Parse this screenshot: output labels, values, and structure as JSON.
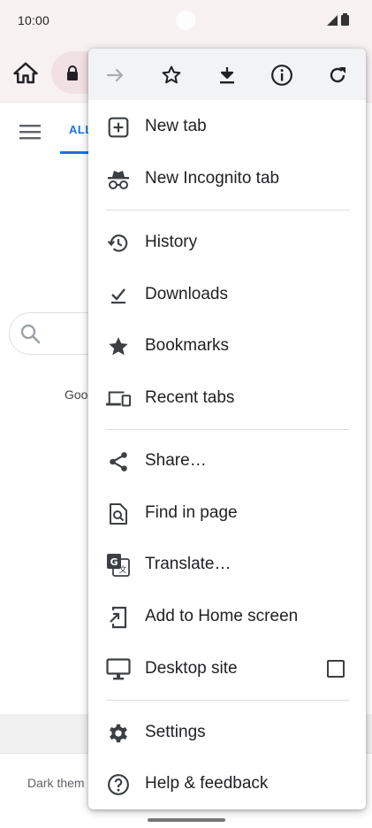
{
  "status_bar": {
    "time": "10:00"
  },
  "page_behind": {
    "tab_label": "ALL",
    "partial_text": "Goo",
    "footer_text": "Dark them"
  },
  "menu": {
    "top_actions": [
      {
        "name": "forward",
        "enabled": false
      },
      {
        "name": "bookmark-star"
      },
      {
        "name": "download"
      },
      {
        "name": "page-info"
      },
      {
        "name": "reload"
      }
    ],
    "items": {
      "new_tab": "New tab",
      "new_incognito_tab": "New Incognito tab",
      "history": "History",
      "downloads": "Downloads",
      "bookmarks": "Bookmarks",
      "recent_tabs": "Recent tabs",
      "share": "Share…",
      "find_in_page": "Find in page",
      "translate": "Translate…",
      "add_to_home_screen": "Add to Home screen",
      "desktop_site": "Desktop site",
      "settings": "Settings",
      "help_feedback": "Help & feedback"
    },
    "desktop_site_checked": false,
    "icon_color": "#3c4043"
  }
}
